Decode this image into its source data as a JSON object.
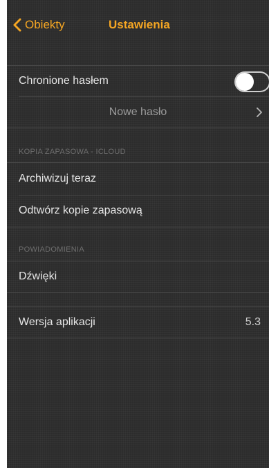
{
  "navbar": {
    "back_label": "Obiekty",
    "title": "Ustawienia"
  },
  "security": {
    "password_label": "Chronione hasłem",
    "password_enabled": false,
    "new_password_label": "Nowe hasło"
  },
  "backup": {
    "header": "KOPIA ZAPASOWA - ICLOUD",
    "archive_now": "Archiwizuj teraz",
    "restore_backup": "Odtwórz kopie zapasową"
  },
  "notifications": {
    "header": "POWIADOMIENIA",
    "sounds": "Dźwięki"
  },
  "about": {
    "version_label": "Wersja aplikacji",
    "version_value": "5.3"
  },
  "colors": {
    "accent": "#f5a623",
    "background": "#2c2c2c",
    "text": "#e6e6e6",
    "secondary_text": "#9a9a9a"
  },
  "icons": {
    "back": "chevron-left-icon",
    "disclosure": "chevron-right-icon"
  }
}
